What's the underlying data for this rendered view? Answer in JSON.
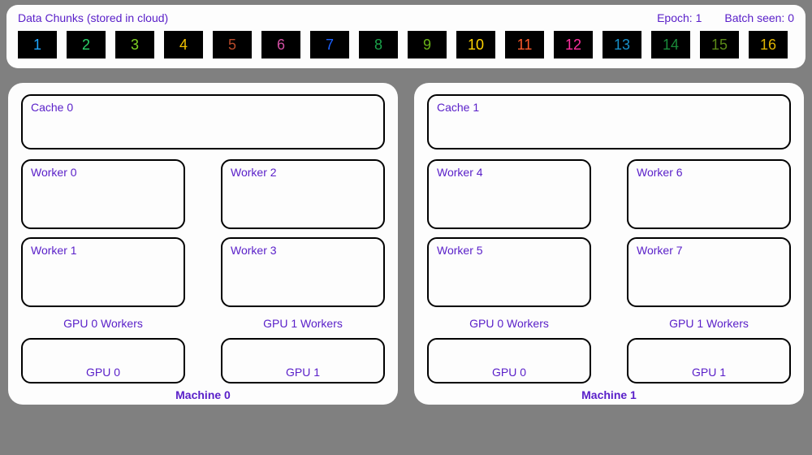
{
  "cloud": {
    "title": "Data Chunks (stored in cloud)",
    "epoch_label": "Epoch:",
    "epoch_value": "1",
    "batch_label": "Batch seen:",
    "batch_value": "0"
  },
  "chunks": [
    {
      "n": "1",
      "color": "#1fa6ff"
    },
    {
      "n": "2",
      "color": "#2bd46a"
    },
    {
      "n": "3",
      "color": "#7ed321"
    },
    {
      "n": "4",
      "color": "#f2c200"
    },
    {
      "n": "5",
      "color": "#b84a2a"
    },
    {
      "n": "6",
      "color": "#d24fa3"
    },
    {
      "n": "7",
      "color": "#1a60ff"
    },
    {
      "n": "8",
      "color": "#1aa34a"
    },
    {
      "n": "9",
      "color": "#6ab417"
    },
    {
      "n": "10",
      "color": "#ffd400"
    },
    {
      "n": "11",
      "color": "#ff5a2a"
    },
    {
      "n": "12",
      "color": "#ff2fa0"
    },
    {
      "n": "13",
      "color": "#1790c9"
    },
    {
      "n": "14",
      "color": "#1a8a3a"
    },
    {
      "n": "15",
      "color": "#5a8a17"
    },
    {
      "n": "16",
      "color": "#e0b400"
    }
  ],
  "machines": [
    {
      "label": "Machine 0",
      "cache": "Cache 0",
      "gpus": [
        {
          "workers": [
            "Worker 0",
            "Worker 1"
          ],
          "workers_label": "GPU 0 Workers",
          "gpu_label": "GPU 0"
        },
        {
          "workers": [
            "Worker 2",
            "Worker 3"
          ],
          "workers_label": "GPU 1 Workers",
          "gpu_label": "GPU 1"
        }
      ]
    },
    {
      "label": "Machine 1",
      "cache": "Cache 1",
      "gpus": [
        {
          "workers": [
            "Worker 4",
            "Worker 5"
          ],
          "workers_label": "GPU 0 Workers",
          "gpu_label": "GPU 0"
        },
        {
          "workers": [
            "Worker 6",
            "Worker 7"
          ],
          "workers_label": "GPU 1 Workers",
          "gpu_label": "GPU 1"
        }
      ]
    }
  ]
}
